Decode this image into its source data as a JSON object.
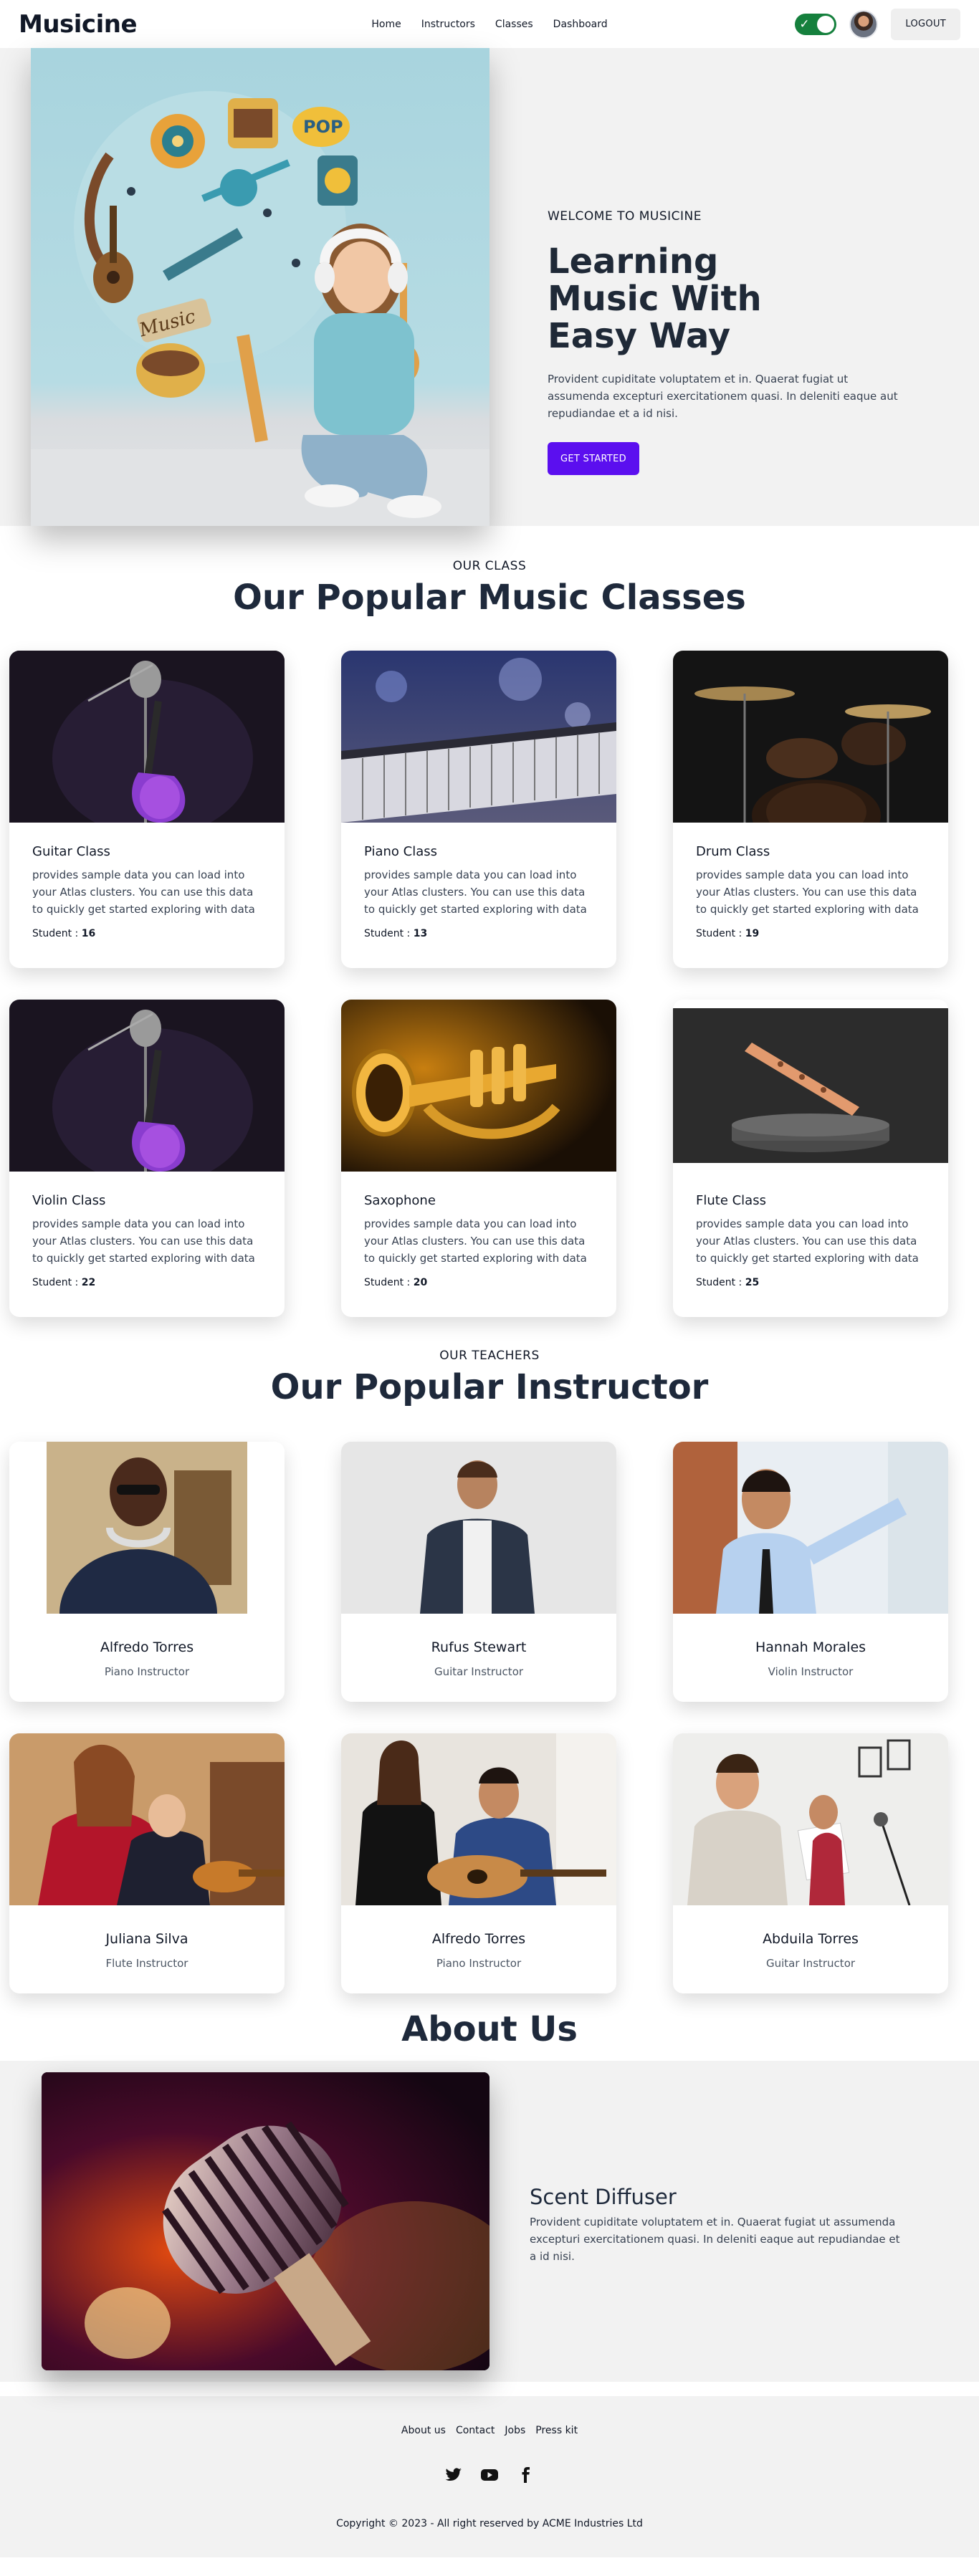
{
  "nav": {
    "brand": "Musicine",
    "links": [
      "Home",
      "Instructors",
      "Classes",
      "Dashboard"
    ],
    "logout_label": "LOGOUT",
    "theme_toggle": "on"
  },
  "hero": {
    "eyebrow": "WELCOME TO MUSICINE",
    "title": "Learning Music With Easy Way",
    "description": "Provident cupiditate voluptatem et in. Quaerat fugiat ut assumenda excepturi exercitationem quasi. In deleniti eaque aut repudiandae et a id nisi.",
    "cta_label": "GET STARTED"
  },
  "classes": {
    "eyebrow": "OUR CLASS",
    "title": "Our Popular Music Classes",
    "student_label": "Student :",
    "items": [
      {
        "name": "Guitar Class",
        "description": "provides sample data you can load into your Atlas clusters. You can use this data to quickly get started exploring with data in",
        "students": "16",
        "image": "guitar"
      },
      {
        "name": "Piano Class",
        "description": "provides sample data you can load into your Atlas clusters. You can use this data to quickly get started exploring with data in",
        "students": "13",
        "image": "piano"
      },
      {
        "name": "Drum Class",
        "description": "provides sample data you can load into your Atlas clusters. You can use this data to quickly get started exploring with data in",
        "students": "19",
        "image": "drums"
      },
      {
        "name": "Violin Class",
        "description": "provides sample data you can load into your Atlas clusters. You can use this data to quickly get started exploring with data in",
        "students": "22",
        "image": "guitar"
      },
      {
        "name": "Saxophone",
        "description": "provides sample data you can load into your Atlas clusters. You can use this data to quickly get started exploring with data in",
        "students": "20",
        "image": "trumpet"
      },
      {
        "name": "Flute Class",
        "description": "provides sample data you can load into your Atlas clusters. You can use this data to quickly get started exploring with data in",
        "students": "25",
        "image": "flute"
      }
    ]
  },
  "instructors": {
    "eyebrow": "OUR TEACHERS",
    "title": "Our Popular Instructor",
    "items": [
      {
        "name": "Alfredo Torres",
        "role": "Piano Instructor"
      },
      {
        "name": "Rufus Stewart",
        "role": "Guitar Instructor"
      },
      {
        "name": "Hannah Morales",
        "role": "Violin Instructor"
      },
      {
        "name": "Juliana Silva",
        "role": "Flute Instructor"
      },
      {
        "name": "Alfredo Torres",
        "role": "Piano Instructor"
      },
      {
        "name": "Abduila Torres",
        "role": "Guitar Instructor"
      }
    ]
  },
  "about": {
    "title": "About Us",
    "heading": "Scent Diffuser",
    "description": "Provident cupiditate voluptatem et in. Quaerat fugiat ut assumenda excepturi exercitationem quasi. In deleniti eaque aut repudiandae et a id nisi."
  },
  "footer": {
    "links": [
      "About us",
      "Contact",
      "Jobs",
      "Press kit"
    ],
    "social": [
      "twitter-icon",
      "youtube-icon",
      "facebook-icon"
    ],
    "copyright": "Copyright © 2023 - All right reserved by ACME Industries Ltd"
  },
  "colors": {
    "accent": "#5b0fef",
    "toggle_on": "#15803d",
    "section_bg": "#f2f2f2"
  }
}
